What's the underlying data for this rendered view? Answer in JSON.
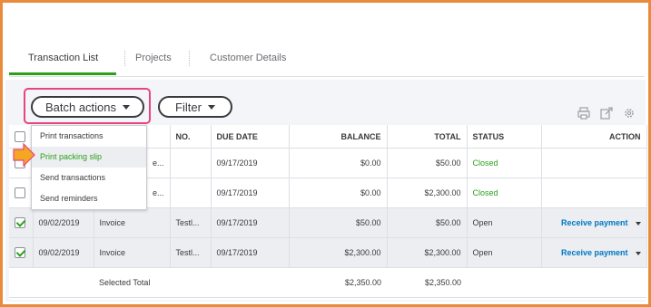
{
  "tabs": [
    "Transaction List",
    "Projects",
    "Customer Details"
  ],
  "toolbar": {
    "batch_actions": "Batch actions",
    "filter": "Filter"
  },
  "batch_menu": [
    "Print transactions",
    "Print packing slip",
    "Send transactions",
    "Send reminders"
  ],
  "table": {
    "headers": {
      "no": "NO.",
      "due_date": "DUE DATE",
      "balance": "BALANCE",
      "total": "TOTAL",
      "status": "STATUS",
      "action": "ACTION"
    },
    "rows": [
      {
        "type_partial": "e...",
        "due_date": "09/17/2019",
        "balance": "$0.00",
        "total": "$50.00",
        "status": "Closed"
      },
      {
        "type_partial": "e...",
        "due_date": "09/17/2019",
        "balance": "$0.00",
        "total": "$2,300.00",
        "status": "Closed"
      },
      {
        "date": "09/02/2019",
        "type": "Invoice",
        "no": "Testl...",
        "due_date": "09/17/2019",
        "balance": "$50.00",
        "total": "$50.00",
        "status": "Open",
        "action": "Receive payment"
      },
      {
        "date": "09/02/2019",
        "type": "Invoice",
        "no": "Testl...",
        "due_date": "09/17/2019",
        "balance": "$2,300.00",
        "total": "$2,300.00",
        "status": "Open",
        "action": "Receive payment"
      }
    ],
    "footer": {
      "label": "Selected Total",
      "balance": "$2,350.00",
      "total": "$2,350.00"
    }
  },
  "colors": {
    "frame": "#e98b3a",
    "highlight": "#e8457c",
    "accent_green": "#2ca01c",
    "link_blue": "#0077c5",
    "arrow": "#f5a623"
  },
  "icons": [
    "print-icon",
    "export-icon",
    "settings-gear-icon",
    "arrow-pointer-icon",
    "checkbox-icon",
    "caret-down-icon"
  ]
}
